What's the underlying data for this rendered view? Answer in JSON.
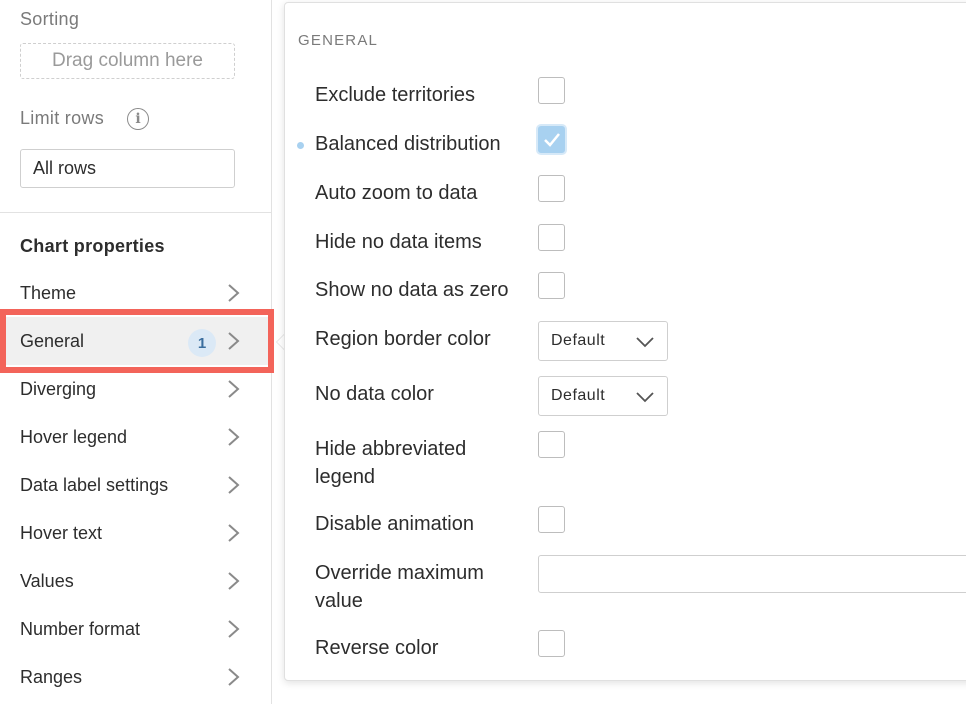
{
  "sidebar": {
    "sorting_title": "Sorting",
    "sorting_placeholder": "Drag column here",
    "limit_rows_title": "Limit rows",
    "limit_rows_value": "All rows",
    "chart_properties_title": "Chart properties",
    "items": [
      {
        "label": "Theme"
      },
      {
        "label": "General",
        "badge": "1"
      },
      {
        "label": "Diverging"
      },
      {
        "label": "Hover legend"
      },
      {
        "label": "Data label settings"
      },
      {
        "label": "Hover text"
      },
      {
        "label": "Values"
      },
      {
        "label": "Number format"
      },
      {
        "label": "Ranges"
      }
    ]
  },
  "popup": {
    "group_label": "GENERAL",
    "exclude_territories": {
      "label": "Exclude territories",
      "checked": false
    },
    "balanced_distribution": {
      "label": "Balanced distribution",
      "checked": true
    },
    "auto_zoom": {
      "label": "Auto zoom to data",
      "checked": false
    },
    "hide_no_data": {
      "label": "Hide no data items",
      "checked": false
    },
    "show_no_data_zero": {
      "label": "Show no data as zero",
      "checked": false
    },
    "region_border_color": {
      "label": "Region border color",
      "value": "Default"
    },
    "no_data_color": {
      "label": "No data color",
      "value": "Default"
    },
    "hide_abbreviated_legend": {
      "label": "Hide abbreviated legend",
      "checked": false
    },
    "disable_animation": {
      "label": "Disable animation",
      "checked": false
    },
    "override_max": {
      "label": "Override maximum value",
      "value": ""
    },
    "reverse_color": {
      "label": "Reverse color",
      "checked": false
    }
  },
  "colors": {
    "accent": "#a8d1f0",
    "highlight": "#f3645a",
    "badge_bg": "#dbe9f6"
  }
}
